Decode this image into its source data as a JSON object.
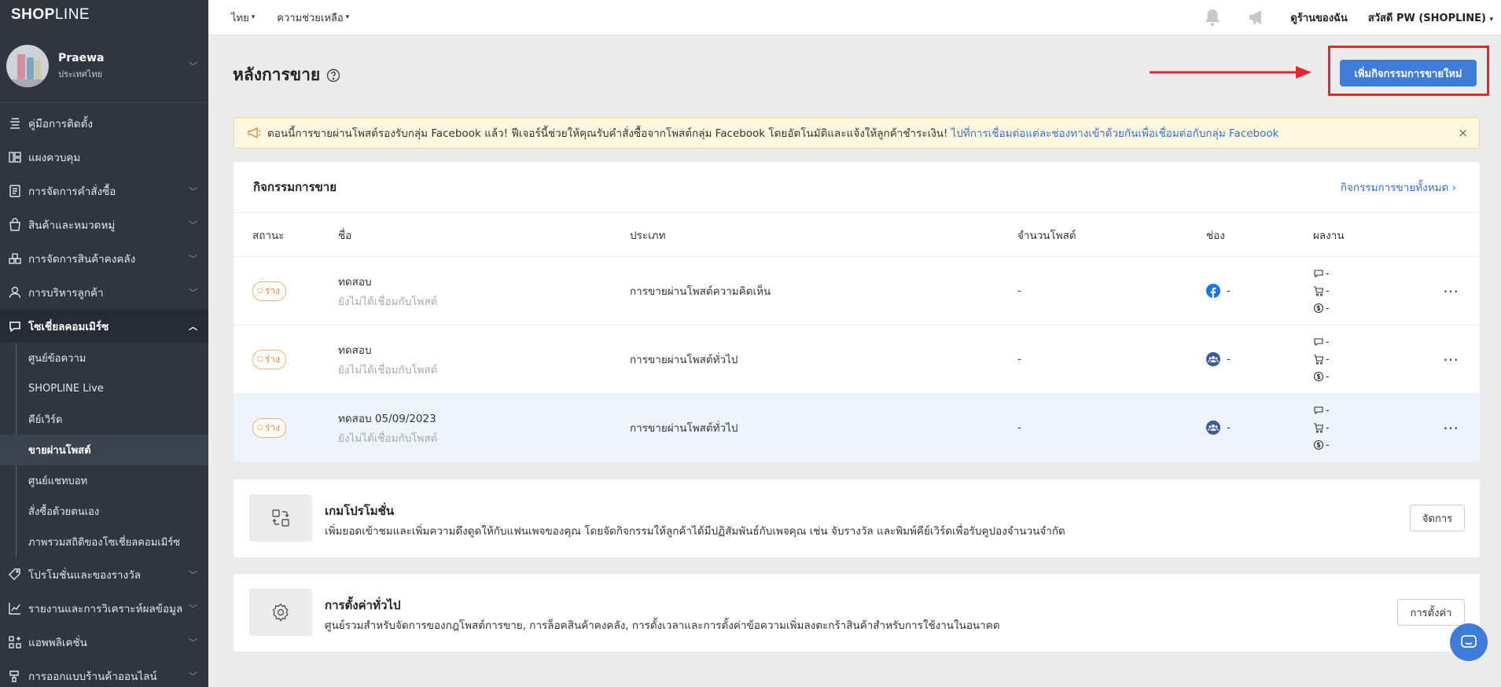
{
  "brand": {
    "logo_bold": "SHOP",
    "logo_thin": "LINE"
  },
  "user": {
    "name": "Praewa",
    "country": "ประเทศไทย"
  },
  "sidebar": {
    "items": [
      {
        "label": "คู่มือการติดตั้ง",
        "icon": "guide-icon"
      },
      {
        "label": "แผงควบคุม",
        "icon": "dashboard-icon"
      },
      {
        "label": "การจัดการคำสั่งซื้อ",
        "icon": "orders-icon"
      },
      {
        "label": "สินค้าและหมวดหมู่",
        "icon": "products-icon"
      },
      {
        "label": "การจัดการสินค้าคงคลัง",
        "icon": "inventory-icon"
      },
      {
        "label": "การบริหารลูกค้า",
        "icon": "customers-icon"
      },
      {
        "label": "โซเชี่ยลคอมเมิร์ซ",
        "icon": "social-commerce-icon"
      }
    ],
    "sub_items": [
      "ศูนย์ข้อความ",
      "SHOPLINE Live",
      "คีย์เวิร์ด",
      "ขายผ่านโพสต์",
      "ศูนย์แชทบอท",
      "สั่งซื้อด้วยตนเอง",
      "ภาพรวมสถิติของโซเชี่ยลคอมเมิร์ซ"
    ],
    "bottom_items": [
      {
        "label": "โปรโมชั่นและของรางวัล",
        "icon": "promotion-icon"
      },
      {
        "label": "รายงานและการวิเคราะห์ผลข้อมูล",
        "icon": "reports-icon"
      },
      {
        "label": "แอพพลิเคชั่น",
        "icon": "apps-icon"
      },
      {
        "label": "การออกแบบร้านค้าออนไลน์",
        "icon": "design-icon"
      }
    ]
  },
  "topbar": {
    "language": "ไทย",
    "help": "ความช่วยเหลือ",
    "store": "ดูร้านของฉัน",
    "greeting": "สวัสดี PW (SHOPLINE)"
  },
  "page": {
    "title": "หลังการขาย",
    "primary_button": "เพิ่มกิจกรรมการขายใหม่"
  },
  "notice": {
    "text": "ตอนนี้การขายผ่านโพสต์รองรับกลุ่ม Facebook แล้ว! ฟีเจอร์นี้ช่วยให้คุณรับคำสั่งซื้อจากโพสต์กลุ่ม Facebook โดยอัตโนมัติและแจ้งให้ลูกค้าชำระเงิน!",
    "link": "ไปที่การเชื่อมต่อแต่ละช่องทางเข้าด้วยกันเพื่อเชื่อมต่อกับกลุ่ม Facebook",
    "close": "×"
  },
  "activities": {
    "title": "กิจกรรมการขาย",
    "view_all": "กิจกรรมการขายทั้งหมด",
    "columns": {
      "status": "สถานะ",
      "name": "ชื่อ",
      "type": "ประเภท",
      "posts": "จำนวนโพสต์",
      "channel": "ช่อง",
      "results": "ผลงาน"
    },
    "rows": [
      {
        "status": "ร่าง",
        "name": "ทดสอบ",
        "sub": "ยังไม่ได้เชื่อมกับโพสต์",
        "type": "การขายผ่านโพสต์ความคิดเห็น",
        "posts": "-",
        "channel": "facebook-icon",
        "channel_value": "-",
        "comments": "-",
        "cart": "-",
        "revenue": "-"
      },
      {
        "status": "ร่าง",
        "name": "ทดสอบ",
        "sub": "ยังไม่ได้เชื่อมกับโพสต์",
        "type": "การขายผ่านโพสต์ทั่วไป",
        "posts": "-",
        "channel": "facebook-group-icon",
        "channel_value": "-",
        "comments": "-",
        "cart": "-",
        "revenue": "-"
      },
      {
        "status": "ร่าง",
        "name": "ทดสอบ 05/09/2023",
        "sub": "ยังไม่ได้เชื่อมกับโพสต์",
        "type": "การขายผ่านโพสต์ทั่วไป",
        "posts": "-",
        "channel": "facebook-group-icon",
        "channel_value": "-",
        "comments": "-",
        "cart": "-",
        "revenue": "-"
      }
    ]
  },
  "promo": {
    "title": "เกมโปรโมชั่น",
    "desc": "เพิ่มยอดเข้าชมและเพิ่มความดึงดูดให้กับแฟนเพจของคุณ โดยจัดกิจกรรมให้ลูกค้าได้มีปฏิสัมพันธ์กับเพจคุณ เช่น จับรางวัล และพิมพ์คีย์เวิร์ดเพื่อรับคูปองจำนวนจำกัด",
    "button": "จัดการ"
  },
  "settings": {
    "title": "การตั้งค่าทั่วไป",
    "desc": "ศูนย์รวมสำหรับจัดการของกฎโพสต์การขาย, การล็อคสินค้าคงคลัง, การตั้งเวลาและการตั้งค่าข้อความเพิ่มลงตะกร้าสินค้าสำหรับการใช้งานในอนาคต",
    "button": "การตั้งค่า"
  },
  "colors": {
    "sidebar": "#2f3640",
    "accent": "#3f7bd9",
    "draft": "#e8863a",
    "annotation": "#e8262b"
  }
}
